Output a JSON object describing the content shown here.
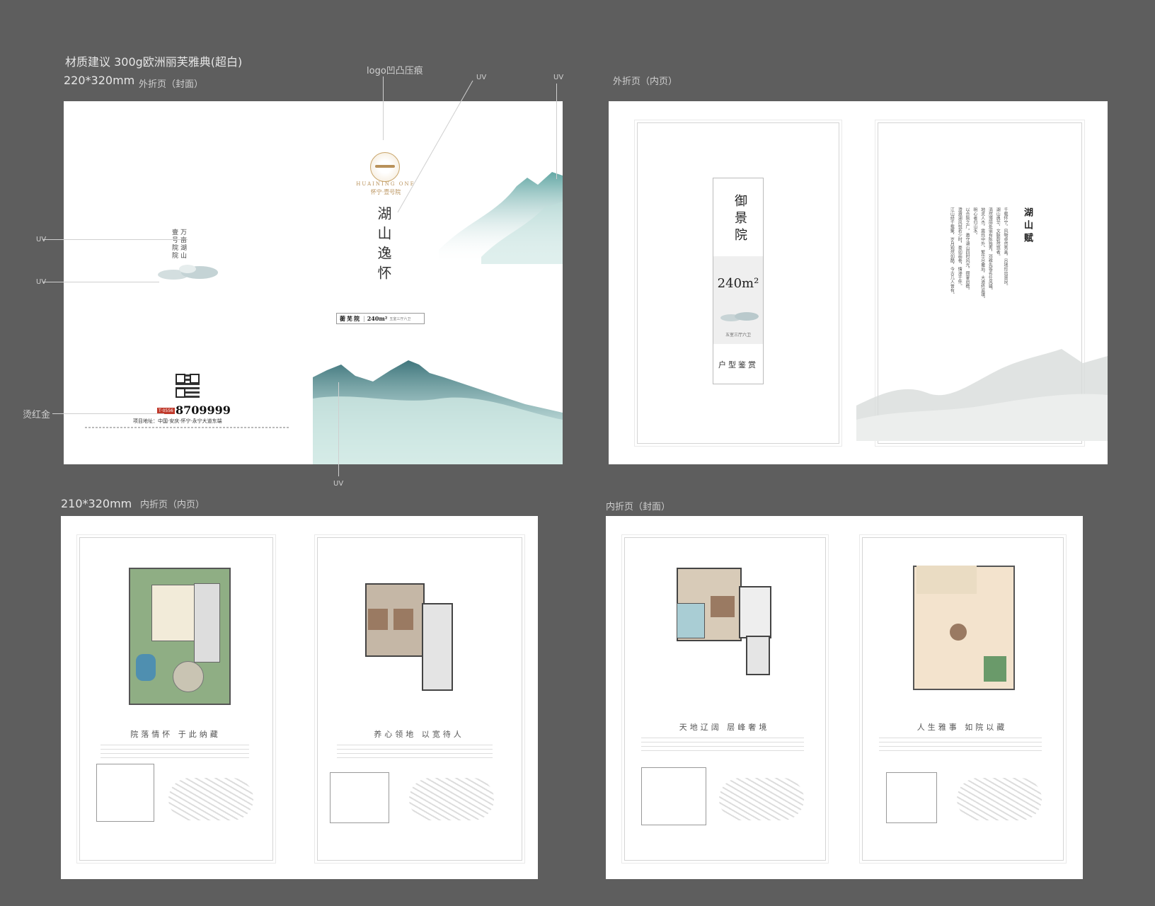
{
  "header": {
    "material": "材质建议  300g欧洲丽芙雅典(超白)",
    "size_outer": "220*320mm",
    "outer_cover_label": "外折页（封面）",
    "logo_note": "logo凹凸压痕"
  },
  "callouts": {
    "uv": "UV",
    "foil": "烫红金"
  },
  "outer_inner_label": "外折页（内页）",
  "size_inner": "210*320mm",
  "inner_inner_label": "内折页（内页）",
  "inner_cover_label": "内折页（封面）",
  "cover": {
    "logo_sub": "HUAINING ONE",
    "logo_cn": "怀宁·壹号院",
    "title": "湖山逸怀",
    "side_text_1": "万亩湖山",
    "side_text_2": "壹号院院",
    "tag_name": "蘅芜院",
    "tag_area": "240m²",
    "tag_type": "五室三厅六卫",
    "phone_prefix": "T·0556",
    "phone": "8709999",
    "address": "项目地址：中国·安庆·怀宁·永宁大道东端"
  },
  "outer_inner": {
    "vertical_title": "御景院",
    "area": "240m²",
    "rooms": "五室三厅六卫",
    "caption": "户型鉴赏",
    "poem_title": "湖山赋",
    "poem_lines": [
      "千载怀宁，风物卓然秀美，吕地形出贤良。",
      "湖山典华，文脉蔚然悠者。",
      "涓然博丽处诞有陈独秀，邓稼先等名仕风骚。",
      "地灵人杰，震烁中外。繁华尽撒后，大道终返璞。",
      "明心者归山水。",
      "以合院之广，邀守湖山四时风光，攒宴启檐。",
      "澄澈湖风悦若少时，豪如画卷，情渗于怀。",
      "江山经千载聚，岁月观然如酷，今古几人曾有。"
    ]
  },
  "inner_pages": [
    {
      "caption": "院落情怀  于此纳藏"
    },
    {
      "caption": "养心领地  以宽待人"
    },
    {
      "caption": "天地辽阔  层峰奢境"
    },
    {
      "caption": "人生雅事  如院以藏"
    }
  ]
}
